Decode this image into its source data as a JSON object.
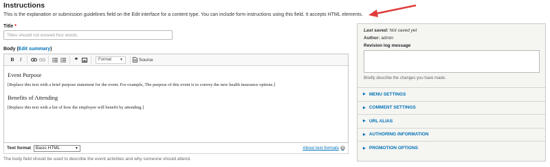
{
  "page": {
    "title": "Instructions",
    "instructions": "This is the explanation or submission guidelines field on the Edit interface for a content type. You can include form instructions using this field. It accepts HTML elements."
  },
  "title_field": {
    "label": "Title",
    "required_marker": "*",
    "placeholder": "Titles should not exceed four words."
  },
  "body_field": {
    "label": "Body",
    "summary_open": "(",
    "summary_link": "Edit summary",
    "summary_close": ")",
    "description": "The body field should be used to describe the event activities and why someone should attend."
  },
  "toolbar": {
    "bold": "B",
    "italic": "I",
    "link_icon": "link-icon",
    "unlink_icon": "unlink-icon",
    "bulleted_list_icon": "bulleted-list-icon",
    "numbered_list_icon": "numbered-list-icon",
    "blockquote": "❞",
    "image_icon": "image-icon",
    "format_label": "Format",
    "source_label": "Source"
  },
  "editor": {
    "heading1": "Event Purpose",
    "paragraph1": "[Replace this text with a brief purpose statement for the event. For example, The purpose of this event is to convey the new health insurance options.]",
    "heading2": "Benefits of Attending",
    "paragraph2": "[Replace this text with a list of how the employee will benefit by attending.]"
  },
  "text_format": {
    "label": "Text format",
    "selected": "Basic HTML",
    "about_link": "About text formats",
    "help_glyph": "?"
  },
  "sidebar": {
    "last_saved_label": "Last saved:",
    "last_saved_value": "Not saved yet",
    "author_label": "Author:",
    "author_value": "admin",
    "revision_label": "Revision log message",
    "revision_desc": "Briefly describe the changes you have made.",
    "sections": [
      "MENU SETTINGS",
      "COMMENT SETTINGS",
      "URL ALIAS",
      "AUTHORING INFORMATION",
      "PROMOTION OPTIONS"
    ]
  },
  "colors": {
    "link": "#0071b8",
    "arrow": "#e03a3a",
    "required": "#ee0000"
  }
}
